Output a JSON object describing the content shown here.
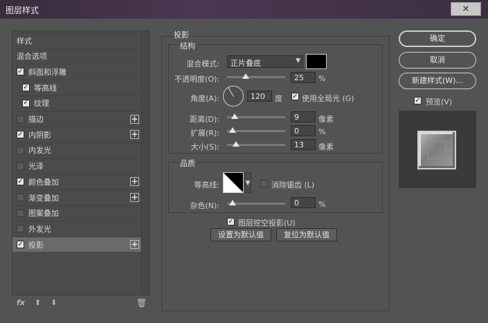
{
  "window": {
    "title": "图层样式",
    "close_glyph": "✕"
  },
  "left": {
    "items": [
      {
        "label": "样式",
        "checkbox": "none",
        "plus": false,
        "indent": 0,
        "selected": false
      },
      {
        "label": "混合选项",
        "checkbox": "none",
        "plus": false,
        "indent": 0,
        "selected": false
      },
      {
        "label": "斜面和浮雕",
        "checkbox": "on",
        "plus": false,
        "indent": 0,
        "selected": false
      },
      {
        "label": "等高线",
        "checkbox": "on",
        "plus": false,
        "indent": 1,
        "selected": false
      },
      {
        "label": "纹理",
        "checkbox": "on",
        "plus": false,
        "indent": 1,
        "selected": false
      },
      {
        "label": "描边",
        "checkbox": "off",
        "plus": true,
        "indent": 0,
        "selected": false
      },
      {
        "label": "内阴影",
        "checkbox": "on",
        "plus": true,
        "indent": 0,
        "selected": false
      },
      {
        "label": "内发光",
        "checkbox": "off",
        "plus": false,
        "indent": 0,
        "selected": false
      },
      {
        "label": "光泽",
        "checkbox": "off",
        "plus": false,
        "indent": 0,
        "selected": false
      },
      {
        "label": "颜色叠加",
        "checkbox": "on",
        "plus": true,
        "indent": 0,
        "selected": false
      },
      {
        "label": "渐变叠加",
        "checkbox": "off",
        "plus": true,
        "indent": 0,
        "selected": false
      },
      {
        "label": "图案叠加",
        "checkbox": "off",
        "plus": false,
        "indent": 0,
        "selected": false
      },
      {
        "label": "外发光",
        "checkbox": "off",
        "plus": false,
        "indent": 0,
        "selected": false
      },
      {
        "label": "投影",
        "checkbox": "on",
        "plus": true,
        "indent": 0,
        "selected": true
      }
    ],
    "tools": {
      "fx": "fx",
      "up": "⬆",
      "down": "⬇",
      "trash": "🗑"
    }
  },
  "panel": {
    "title": "投影",
    "structure": {
      "title": "结构",
      "blend_mode": {
        "label": "混合模式:",
        "value": "正片叠底",
        "color": "#000000"
      },
      "opacity": {
        "label": "不透明度(O):",
        "value": "25",
        "unit": "%",
        "level": 0.25
      },
      "angle": {
        "label": "角度(A):",
        "value": "120",
        "unit": "度",
        "global_light_label": "使用全局光 (G)",
        "global_light": true
      },
      "distance": {
        "label": "距离(D):",
        "value": "9",
        "unit": "像素",
        "level": 0.04
      },
      "spread": {
        "label": "扩展(R):",
        "value": "0",
        "unit": "%",
        "level": 0.0
      },
      "size": {
        "label": "大小(S):",
        "value": "13",
        "unit": "像素",
        "level": 0.06
      }
    },
    "quality": {
      "title": "品质",
      "contour_label": "等高线:",
      "antialias_label": "消除锯齿 (L)",
      "antialias": false,
      "noise": {
        "label": "杂色(N):",
        "value": "0",
        "unit": "%",
        "level": 0.0
      }
    },
    "knockout_label": "图层挖空投影(U)",
    "knockout": true,
    "set_default_label": "设置为默认值",
    "reset_default_label": "复位为默认值"
  },
  "right": {
    "ok_label": "确定",
    "cancel_label": "取消",
    "new_style_label": "新建样式(W)...",
    "preview_label": "预览(V)",
    "preview_checked": true
  }
}
